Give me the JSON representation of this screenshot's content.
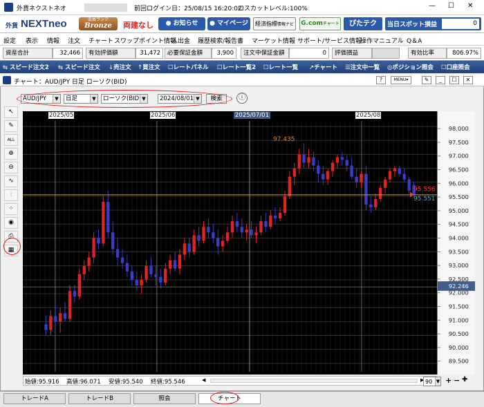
{
  "window": {
    "title": "外貨ネクストネオ",
    "last_login": "前回ログイン日：25/08/15 16:20:02",
    "loss_cut_level": "ロスカットレベル:100%",
    "win_buttons": [
      "—",
      "☐",
      "✕"
    ]
  },
  "branding": {
    "logo_prefix": "外貨",
    "logo_main": "NEXTneo",
    "rank_label": "会員ランク",
    "rank": "Bronze",
    "ryoudate": "両建なし",
    "notice_btn": "お知らせ",
    "mypage_btn": "マイページ",
    "keizai_btn": "経済指標",
    "keizai_sub": "情報ナビ",
    "gcom_btn": "G.com",
    "gcom_sub": "チャート",
    "pitatec_btn": "ぴたテク",
    "spot_label": "当日スポット損益",
    "spot_value": "0"
  },
  "menu": [
    "設定",
    "表示",
    "情報",
    "注文",
    "チャート",
    "スワップポイント情報",
    "入出金",
    "履歴検索/報告書",
    "マーケット情報",
    "サポート/サービス情報",
    "操作マニュアル",
    "Q＆A"
  ],
  "status": {
    "shisan_label": "資産合計",
    "shisan_value": "32,466",
    "yuukou_label": "有効評価額",
    "yuukou_value": "31,472",
    "hitsuyou_label": "必要保証金額",
    "hitsuyou_value": "3,900",
    "chuumon_label": "注文中保証金額",
    "chuumon_value": "0",
    "hyouka_label": "評価損益",
    "hyouka_value": "",
    "hiritsu_label": "有効比率",
    "hiritsu_value": "806.97%"
  },
  "toolbar": [
    "スピード注文2",
    "スピード注文",
    "売注文",
    "買注文",
    "レートパネル",
    "レート一覧2",
    "レート一覧",
    "チャート",
    "注文中一覧",
    "ポジション照会",
    "口座照会"
  ],
  "chart_window": {
    "title": "チャート：AUD/JPY 日足 ローソク(BID)",
    "menu_btn": "MENU",
    "pair": "AUD/JPY",
    "period": "日足",
    "chart_kind": "ローソク(BID)",
    "date": "2024/08/01",
    "search_btn": "検索",
    "bar_count": "90"
  },
  "footer": {
    "open_label": "始値:",
    "open": "95.916",
    "high_label": "高値:",
    "high": "96.071",
    "low_label": "安値:",
    "low": "95.540",
    "close_label": "終値:",
    "close": "95.546"
  },
  "tabs": [
    "トレードA",
    "トレードB",
    "照会",
    "チャート"
  ],
  "colors": {
    "up": "#e02424",
    "down": "#3b3bcc",
    "bg": "#000000",
    "hline": "#d89a2a",
    "accent": "#2b5aa8"
  },
  "chart_data": {
    "type": "candlestick",
    "title": "AUD/JPY 日足 ローソク(BID)",
    "x_labels": [
      "2025/05",
      "2025/06",
      "2025/07/01",
      "2025/08"
    ],
    "y_ticks": [
      "98.000",
      "97.500",
      "97.000",
      "96.500",
      "96.000",
      "95.500",
      "95.000",
      "94.500",
      "94.000",
      "93.500",
      "93.000",
      "92.500",
      "92.000",
      "91.500",
      "91.000",
      "90.500",
      "90.000",
      "89.500"
    ],
    "ylim": [
      89.2,
      98.2
    ],
    "annotations": {
      "max_label": "97.435",
      "bid": "95.556",
      "ask": "95.551",
      "crosshair": "92.246"
    },
    "hline": 95.55,
    "crosshair_y": 92.246,
    "candles": [
      [
        90.9,
        91.2,
        90.5,
        90.7
      ],
      [
        90.7,
        91.4,
        90.5,
        91.2
      ],
      [
        91.2,
        91.6,
        90.8,
        91.0
      ],
      [
        91.0,
        91.5,
        90.6,
        91.3
      ],
      [
        91.3,
        91.7,
        91.0,
        91.1
      ],
      [
        91.1,
        92.3,
        91.0,
        92.1
      ],
      [
        92.1,
        92.3,
        91.7,
        91.9
      ],
      [
        91.9,
        92.9,
        91.8,
        92.7
      ],
      [
        92.7,
        93.2,
        92.5,
        93.0
      ],
      [
        93.0,
        93.5,
        92.8,
        93.3
      ],
      [
        93.3,
        94.2,
        93.1,
        94.0
      ],
      [
        94.0,
        94.3,
        93.6,
        93.8
      ],
      [
        93.8,
        95.5,
        93.7,
        95.3
      ],
      [
        95.3,
        95.7,
        94.0,
        94.2
      ],
      [
        94.2,
        94.6,
        93.4,
        93.6
      ],
      [
        93.6,
        94.0,
        93.0,
        93.3
      ],
      [
        93.3,
        93.6,
        92.9,
        93.1
      ],
      [
        93.1,
        93.4,
        92.6,
        92.8
      ],
      [
        92.8,
        93.0,
        92.3,
        92.5
      ],
      [
        92.5,
        92.8,
        92.1,
        92.3
      ],
      [
        92.3,
        92.7,
        92.0,
        92.5
      ],
      [
        92.5,
        93.2,
        92.4,
        93.0
      ],
      [
        93.0,
        93.3,
        92.6,
        92.7
      ],
      [
        92.7,
        93.0,
        92.3,
        92.6
      ],
      [
        92.6,
        92.9,
        92.2,
        92.4
      ],
      [
        92.4,
        93.1,
        92.3,
        92.9
      ],
      [
        92.9,
        93.4,
        92.7,
        93.2
      ],
      [
        93.2,
        93.5,
        92.8,
        92.9
      ],
      [
        92.9,
        93.6,
        92.7,
        93.4
      ],
      [
        93.4,
        94.0,
        93.2,
        93.8
      ],
      [
        93.8,
        94.0,
        93.3,
        93.5
      ],
      [
        93.5,
        94.3,
        93.4,
        94.1
      ],
      [
        94.1,
        94.4,
        93.7,
        93.9
      ],
      [
        93.9,
        94.6,
        93.8,
        94.4
      ],
      [
        94.4,
        94.7,
        94.0,
        94.2
      ],
      [
        94.2,
        94.5,
        93.8,
        94.0
      ],
      [
        94.0,
        94.3,
        93.4,
        93.7
      ],
      [
        93.7,
        94.1,
        93.5,
        93.9
      ],
      [
        93.9,
        94.4,
        93.8,
        94.2
      ],
      [
        94.2,
        94.8,
        94.0,
        94.6
      ],
      [
        94.6,
        94.9,
        94.2,
        94.4
      ],
      [
        94.4,
        94.7,
        94.0,
        94.2
      ],
      [
        94.2,
        94.5,
        93.9,
        94.3
      ],
      [
        94.3,
        94.6,
        94.0,
        94.1
      ],
      [
        94.1,
        94.4,
        93.8,
        94.2
      ],
      [
        94.2,
        94.8,
        94.1,
        94.6
      ],
      [
        94.6,
        94.9,
        94.2,
        94.4
      ],
      [
        94.4,
        95.0,
        94.3,
        94.8
      ],
      [
        94.8,
        95.1,
        94.5,
        94.7
      ],
      [
        94.7,
        95.1,
        94.6,
        94.9
      ],
      [
        94.9,
        95.7,
        94.8,
        95.5
      ],
      [
        95.5,
        96.4,
        95.4,
        96.2
      ],
      [
        96.2,
        96.7,
        95.9,
        96.5
      ],
      [
        96.5,
        97.2,
        96.3,
        97.0
      ],
      [
        97.0,
        97.4,
        96.5,
        96.7
      ],
      [
        96.7,
        97.2,
        96.5,
        96.9
      ],
      [
        96.9,
        97.1,
        96.4,
        96.6
      ],
      [
        96.6,
        96.8,
        96.0,
        96.3
      ],
      [
        96.3,
        96.6,
        95.9,
        96.1
      ],
      [
        96.1,
        96.5,
        95.9,
        96.4
      ],
      [
        96.4,
        96.8,
        96.2,
        96.7
      ],
      [
        96.7,
        97.0,
        96.5,
        96.9
      ],
      [
        96.9,
        97.1,
        96.6,
        96.8
      ],
      [
        96.8,
        97.0,
        96.4,
        96.6
      ],
      [
        96.6,
        96.9,
        96.1,
        96.2
      ],
      [
        96.2,
        96.5,
        95.8,
        96.0
      ],
      [
        96.0,
        96.4,
        95.8,
        96.3
      ],
      [
        96.3,
        96.6,
        95.0,
        95.2
      ],
      [
        95.2,
        95.5,
        94.9,
        95.1
      ],
      [
        95.1,
        95.6,
        95.0,
        95.4
      ],
      [
        95.4,
        95.9,
        95.3,
        95.8
      ],
      [
        95.8,
        96.2,
        95.6,
        96.1
      ],
      [
        96.1,
        96.5,
        96.0,
        96.4
      ],
      [
        96.4,
        96.6,
        96.2,
        96.5
      ],
      [
        96.5,
        96.6,
        96.2,
        96.3
      ],
      [
        96.3,
        96.5,
        96.0,
        96.1
      ],
      [
        96.1,
        96.2,
        95.6,
        95.7
      ],
      [
        95.9,
        96.0,
        95.5,
        95.55
      ]
    ]
  }
}
